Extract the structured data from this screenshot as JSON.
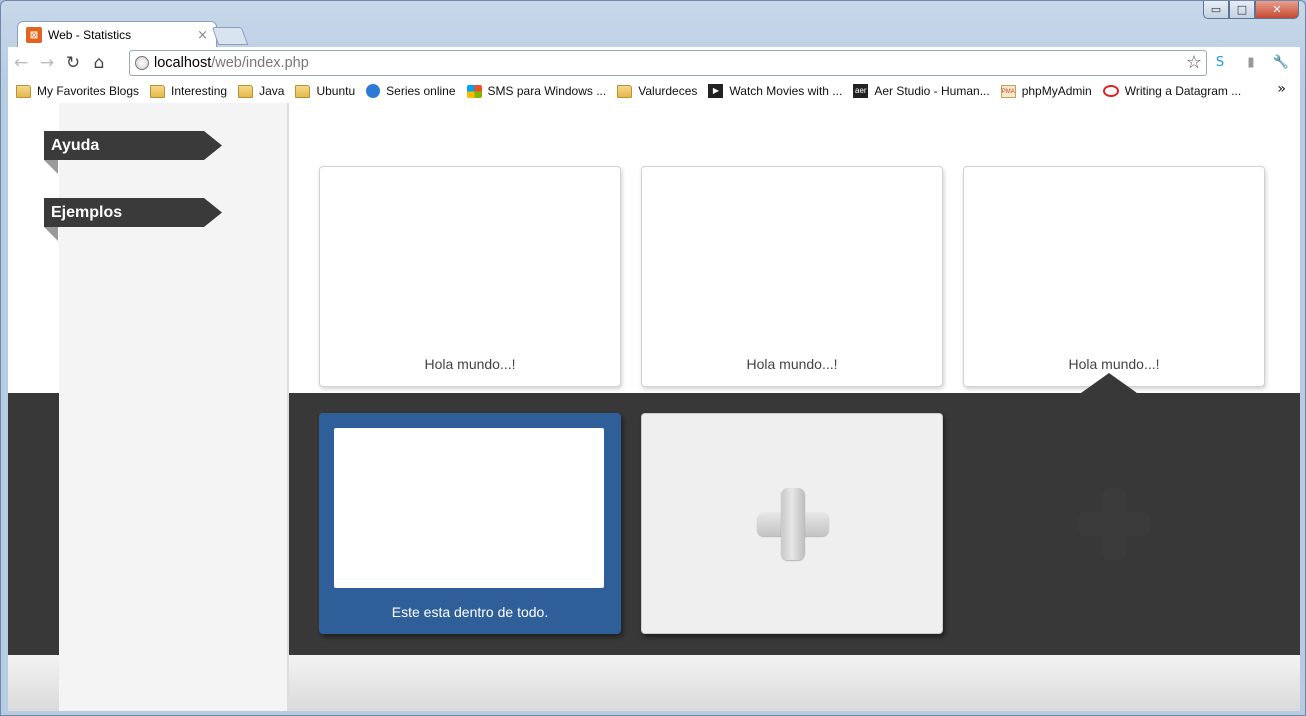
{
  "browser": {
    "tab_title": "Web - Statistics",
    "tab_favicon": "xampp-icon",
    "tab_close": "×",
    "url_host": "localhost",
    "url_path": "/web/index.php",
    "window_controls": {
      "minimize": "▭",
      "maximize": "□",
      "close": "✕"
    },
    "nav": {
      "back": "←",
      "forward": "→",
      "reload": "↻",
      "home": "⌂"
    },
    "star": "☆",
    "wrench": "🔧",
    "bookmarks_overflow": "»"
  },
  "bookmarks": [
    {
      "label": "My Favorites Blogs",
      "icon": "folder-icon"
    },
    {
      "label": "Interesting",
      "icon": "folder-icon"
    },
    {
      "label": "Java",
      "icon": "folder-icon"
    },
    {
      "label": "Ubuntu",
      "icon": "folder-icon"
    },
    {
      "label": "Series online",
      "icon": "globe-icon"
    },
    {
      "label": "SMS para Windows ...",
      "icon": "windows-icon"
    },
    {
      "label": "Valurdeces",
      "icon": "folder-icon"
    },
    {
      "label": "Watch Movies with ...",
      "icon": "movie-icon"
    },
    {
      "label": "Aer Studio - Human...",
      "icon": "aer-icon"
    },
    {
      "label": "phpMyAdmin",
      "icon": "phpmyadmin-icon"
    },
    {
      "label": "Writing a Datagram ...",
      "icon": "oracle-icon"
    }
  ],
  "sidebar": {
    "items": [
      {
        "label": "Ayuda"
      },
      {
        "label": "Ejemplos"
      }
    ]
  },
  "cards_top": [
    {
      "caption": "Hola mundo...!"
    },
    {
      "caption": "Hola mundo...!"
    },
    {
      "caption": "Hola mundo...!"
    }
  ],
  "cards_bottom": {
    "selected_caption": "Este esta dentro de todo.",
    "add_icon": "plus-icon"
  },
  "colors": {
    "band": "#383838",
    "selected_card": "#2f5f99",
    "ribbon": "#3a3a3a"
  }
}
